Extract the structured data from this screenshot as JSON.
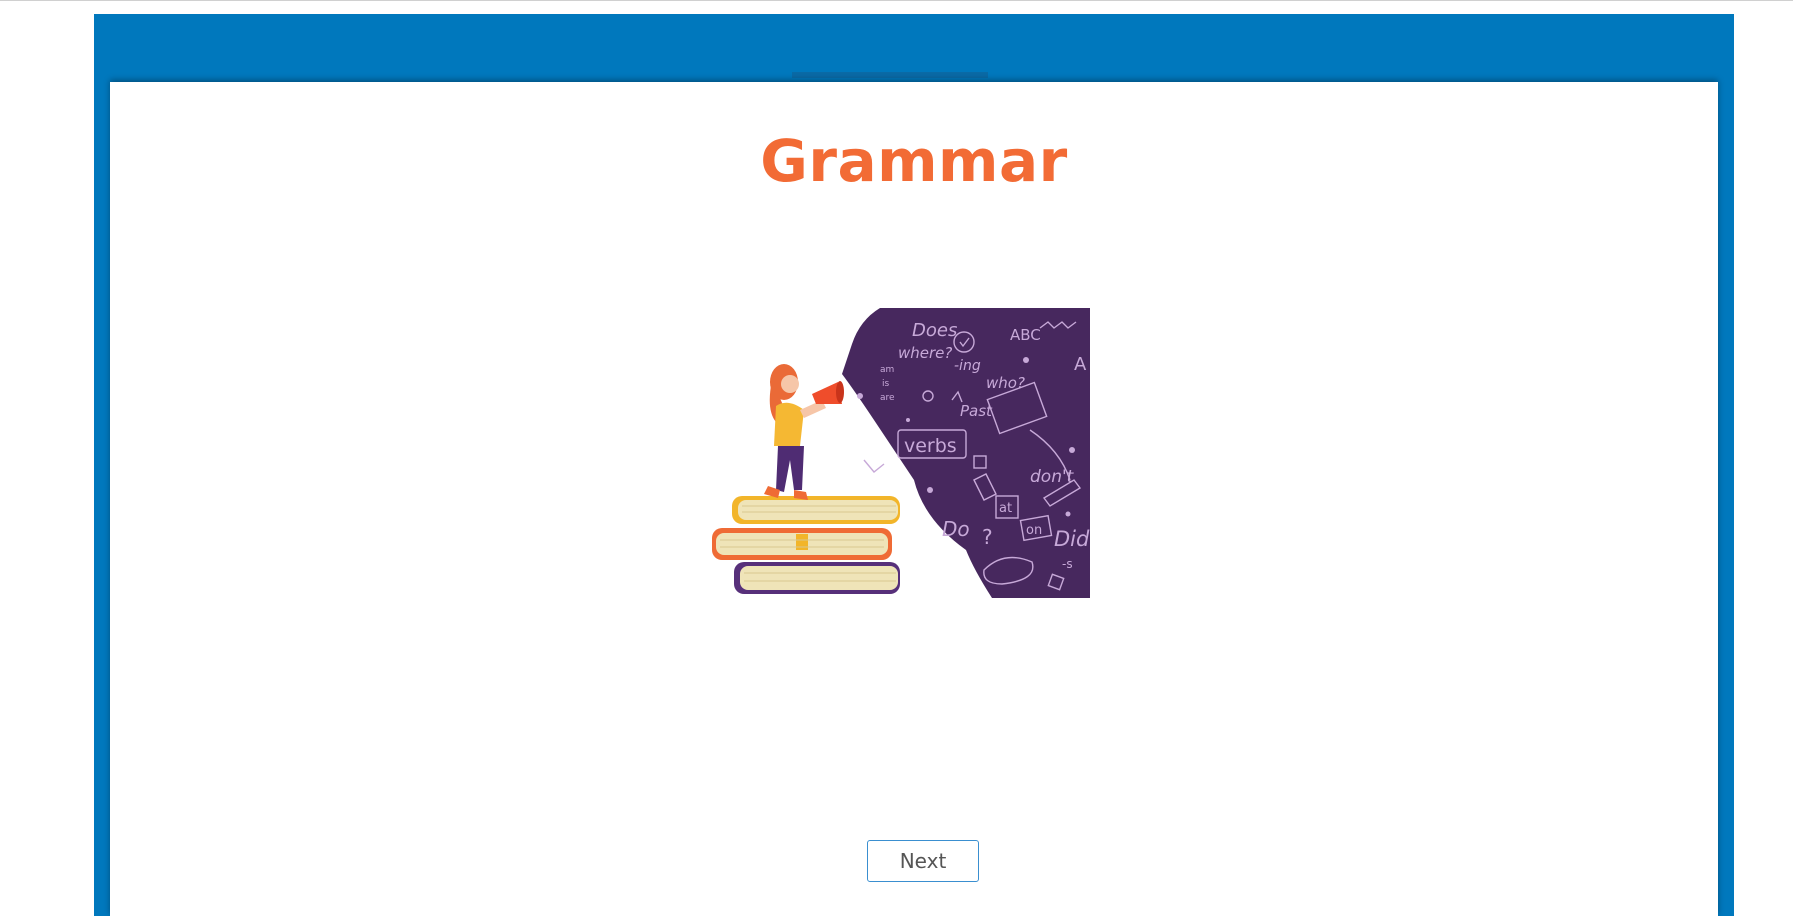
{
  "page": {
    "title": "Grammar"
  },
  "illustration": {
    "icon": "girl-with-megaphone-on-books-illustration",
    "doodle_text": [
      "Does",
      "where?",
      "ABC",
      "-ing",
      "who?",
      "am",
      "is",
      "are",
      "Past",
      "verbs",
      "A",
      "don't",
      "at",
      "on",
      "Do",
      "Did",
      "-s",
      "?"
    ]
  },
  "footer": {
    "next_label": "Next"
  },
  "colors": {
    "frame": "#0078bd",
    "title": "#f26b35",
    "doodle_bg": "#47285e",
    "button_border": "#3a8fd0"
  }
}
